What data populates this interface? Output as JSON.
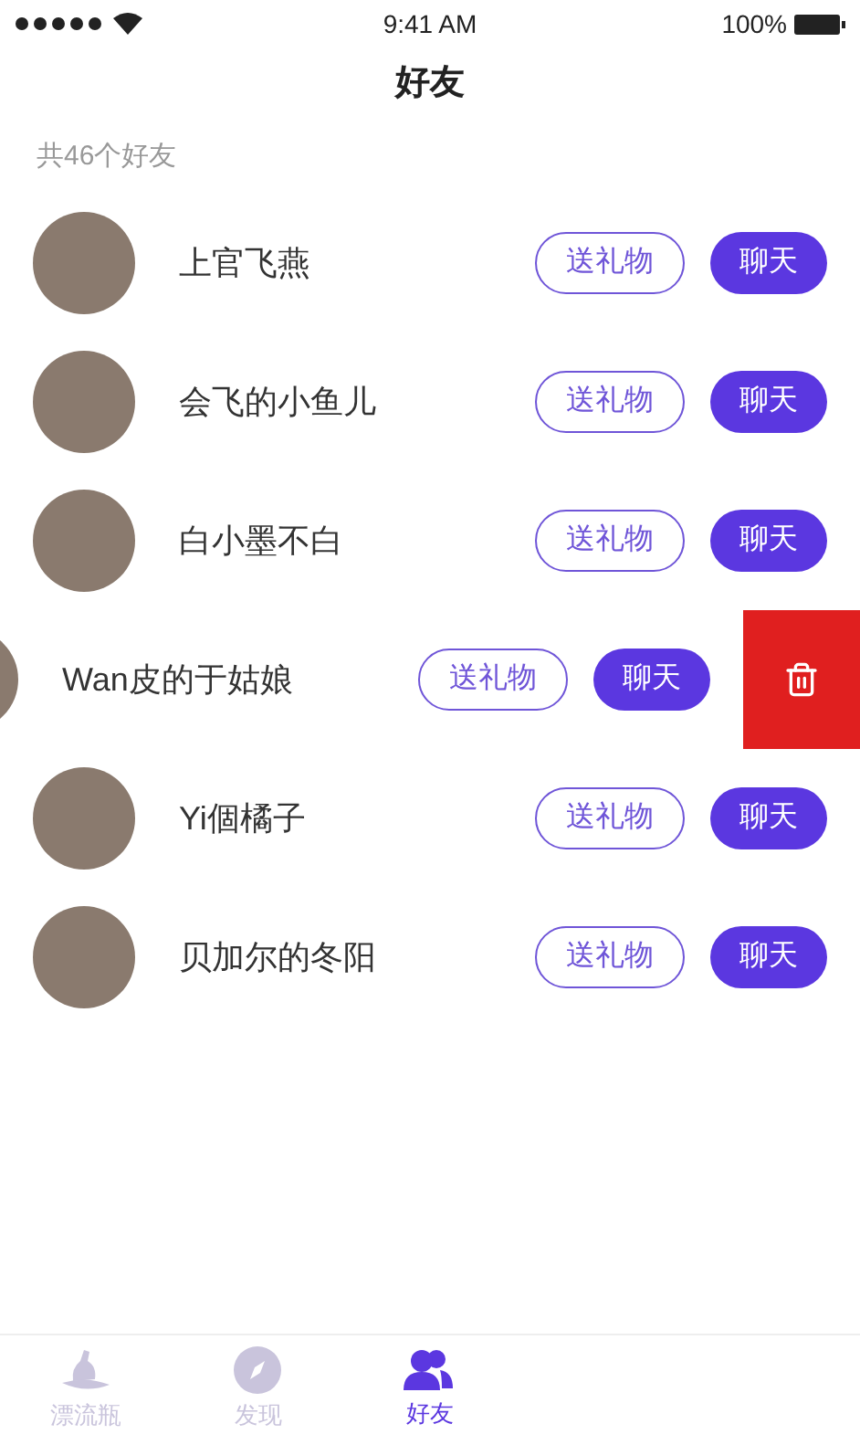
{
  "status_bar": {
    "time": "9:41 AM",
    "battery": "100%"
  },
  "title": "好友",
  "count_label": "共46个好友",
  "friends": [
    {
      "name": "上官飞燕",
      "gift": "送礼物",
      "chat": "聊天",
      "swiped": false
    },
    {
      "name": "会飞的小鱼儿",
      "gift": "送礼物",
      "chat": "聊天",
      "swiped": false
    },
    {
      "name": "白小墨不白",
      "gift": "送礼物",
      "chat": "聊天",
      "swiped": false
    },
    {
      "name": "Wan皮的于姑娘",
      "gift": "送礼物",
      "chat": "聊天",
      "swiped": true
    },
    {
      "name": "Yi個橘子",
      "gift": "送礼物",
      "chat": "聊天",
      "swiped": false
    },
    {
      "name": "贝加尔的冬阳",
      "gift": "送礼物",
      "chat": "聊天",
      "swiped": false
    }
  ],
  "tab_bar": [
    {
      "kind": "bottle",
      "label": "漂流瓶",
      "selected": false
    },
    {
      "kind": "compass",
      "label": "发现",
      "selected": false
    },
    {
      "kind": "friends",
      "label": "好友",
      "selected": true
    }
  ]
}
